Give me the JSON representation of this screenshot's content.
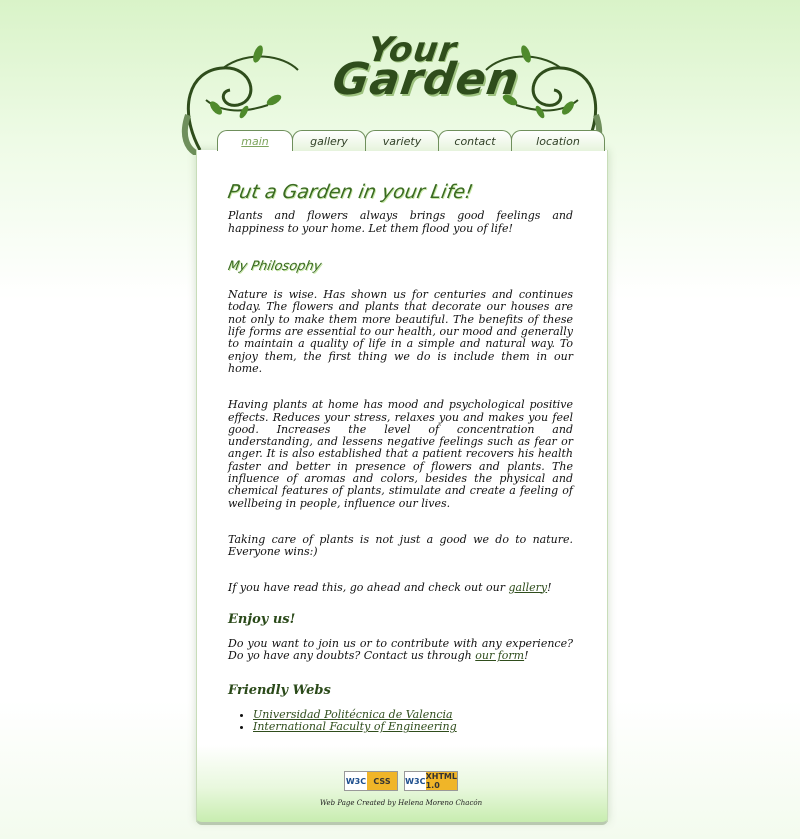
{
  "header": {
    "logo_line1": "Your",
    "logo_line2": "Garden"
  },
  "tabs": [
    {
      "label": "main",
      "active": true
    },
    {
      "label": "gallery",
      "active": false
    },
    {
      "label": "variety",
      "active": false
    },
    {
      "label": "contact",
      "active": false
    },
    {
      "label": "location",
      "active": false
    }
  ],
  "main": {
    "title": "Put a Garden in your Life!",
    "intro": "Plants and flowers always brings good feelings and happiness to your home. Let them flood you of life!",
    "philosophy_heading": "My Philosophy",
    "para1": "Nature is wise. Has shown us for centuries and continues today. The flowers and plants that decorate our houses are not only to make them more beautiful. The benefits of these life forms are essential to our health, our mood and generally to maintain a quality of life in a simple and natural way. To enjoy them, the first thing we do is include them in our home.",
    "para2": "Having plants at home has mood and psychological positive effects. Reduces your stress, relaxes you and makes you feel good. Increases the level of concentration and understanding, and lessens negative feelings such as fear or anger. It is also established that a patient recovers his health faster and better in presence of flowers and plants. The influence of aromas and colors, besides the physical and chemical features of plants, stimulate and create a feeling of wellbeing in people, influence our lives.",
    "para3": "Taking care of plants is not just a good we do to nature. Everyone wins:)",
    "para4_before": "If you have read this, go ahead and check out our ",
    "para4_link": "gallery",
    "para4_after": "!",
    "enjoy_heading": "Enjoy us!",
    "enjoy_before": "Do you want to join us or to contribute with any experience? Do yo have any doubts? Contact us through ",
    "enjoy_link": "our form",
    "enjoy_after": "!",
    "webs_heading": "Friendly Webs",
    "webs": [
      "Universidad Politécnica de Valencia",
      "International Faculty of Engineering"
    ]
  },
  "footer": {
    "badge_css": {
      "w3": "W3C",
      "kind": "CSS"
    },
    "badge_xhtml": {
      "w3": "W3C",
      "kind": "XHTML 1.0"
    },
    "credit": "Web Page Created by Helena Moreno Chacón"
  },
  "colors": {
    "accent": "#3b6b22",
    "heading": "#2b4a1a",
    "footer_green": "#c8edb0"
  },
  "icons": [
    "vine-left-icon",
    "vine-right-icon",
    "w3c-css-icon",
    "w3c-xhtml-icon"
  ]
}
